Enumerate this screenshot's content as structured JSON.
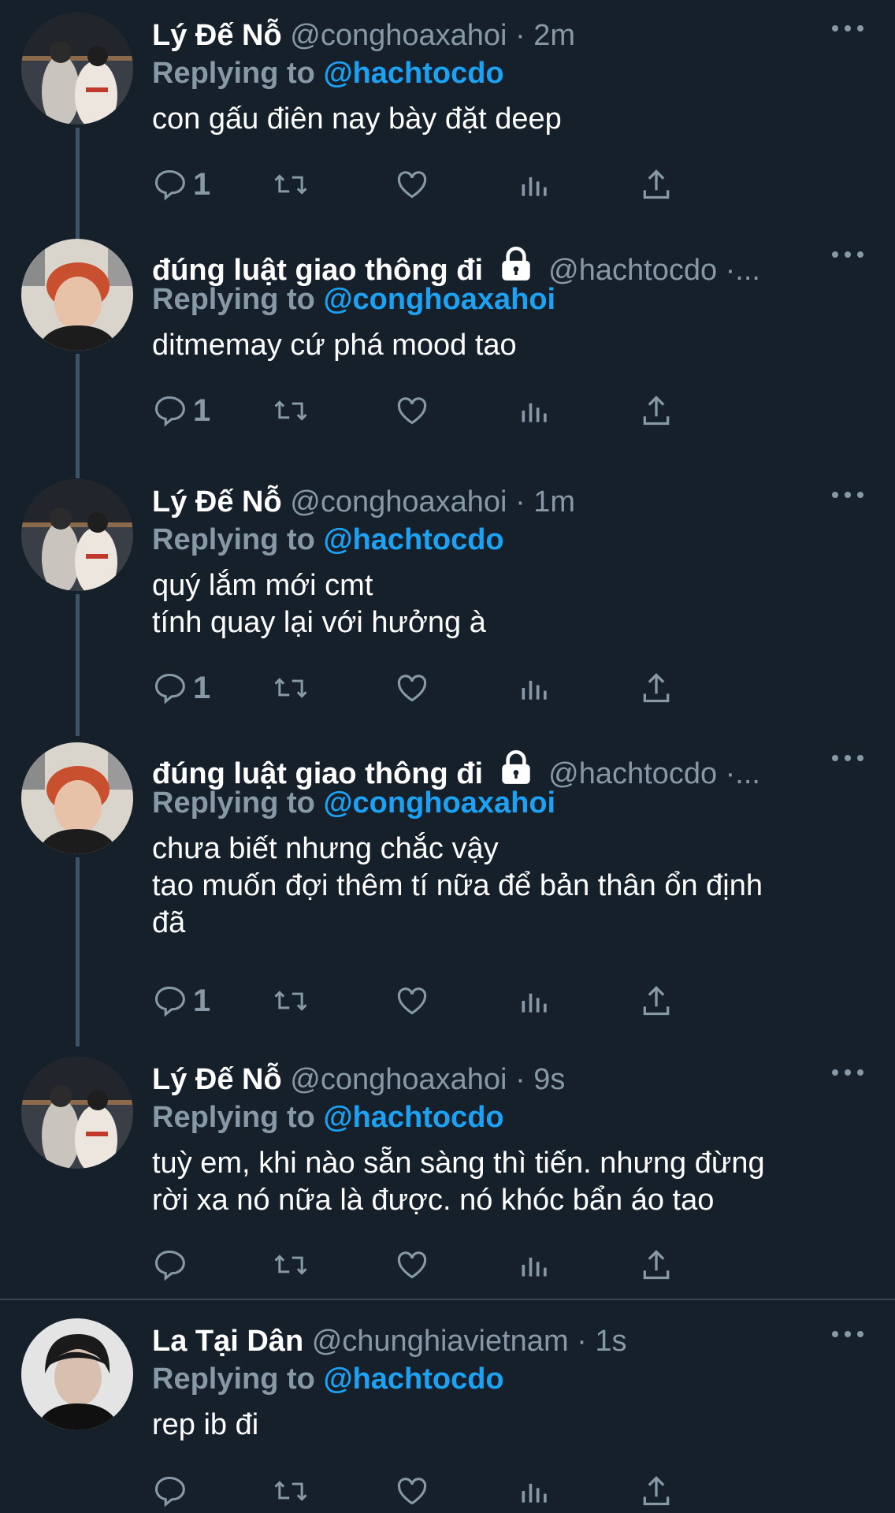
{
  "tweets": [
    {
      "name": "Lý Đế Nỗ",
      "handle": "@conghoaxahoi",
      "time": "· 2m",
      "locked": false,
      "replying_pre": "Replying to",
      "replying_to": "@hachtocdo",
      "text": "con gấu điên nay bày đặt deep",
      "reply_count": "1",
      "avatar": "avatar-1"
    },
    {
      "name": "đúng luật giao thông đi",
      "handle": "@hachtocdo ·...",
      "time": "",
      "locked": true,
      "replying_pre": "Replying to",
      "replying_to": "@conghoaxahoi",
      "text": "ditmemay cứ phá mood tao",
      "reply_count": "1",
      "avatar": "avatar-2"
    },
    {
      "name": "Lý Đế Nỗ",
      "handle": "@conghoaxahoi",
      "time": "· 1m",
      "locked": false,
      "replying_pre": "Replying to",
      "replying_to": "@hachtocdo",
      "text": "quý lắm mới cmt\ntính quay lại với hưởng à",
      "reply_count": "1",
      "avatar": "avatar-1"
    },
    {
      "name": "đúng luật giao thông đi",
      "handle": "@hachtocdo ·...",
      "time": "",
      "locked": true,
      "replying_pre": "Replying to",
      "replying_to": "@conghoaxahoi",
      "text": "chưa biết nhưng chắc vậy\ntao muốn đợi thêm tí nữa để bản thân ổn định\nđã",
      "reply_count": "1",
      "avatar": "avatar-2"
    },
    {
      "name": "Lý Đế Nỗ",
      "handle": "@conghoaxahoi",
      "time": "· 9s",
      "locked": false,
      "replying_pre": "Replying to",
      "replying_to": "@hachtocdo",
      "text": "tuỳ em, khi nào sẵn sàng thì tiến. nhưng đừng\nrời xa nó nữa là được. nó khóc bẩn áo tao",
      "reply_count": "",
      "avatar": "avatar-1"
    },
    {
      "name": "La Tại Dân",
      "handle": "@chunghiavietnam",
      "time": "· 1s",
      "locked": false,
      "replying_pre": "Replying to",
      "replying_to": "@hachtocdo",
      "text": "rep ib đi",
      "reply_count": "",
      "avatar": "avatar-3"
    }
  ],
  "colors": {
    "background": "#15202b",
    "muted": "#8899a6",
    "link": "#1da1f2",
    "thread_line": "#3d5466"
  },
  "icons": [
    "reply-icon",
    "retweet-icon",
    "like-icon",
    "analytics-icon",
    "share-icon",
    "more-icon",
    "lock-icon"
  ]
}
